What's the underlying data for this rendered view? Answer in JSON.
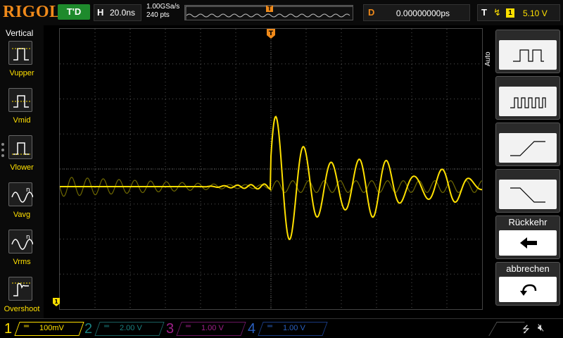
{
  "header": {
    "logo": "RIGOL",
    "trigger_status": "T'D",
    "horizontal_letter": "H",
    "timebase": "20.0ns",
    "sample_rate": "1.00GSa/s",
    "memory_depth": "240 pts",
    "memory_marker": "T",
    "delay_letter": "D",
    "delay_value": "0.00000000ps",
    "trigger_letter": "T",
    "trigger_edge_icon": "rising-edge-icon",
    "trigger_source": "1",
    "trigger_level": "5.10 V"
  },
  "sidebar": {
    "title": "Vertical",
    "items": [
      {
        "label": "Vupper",
        "icon": "vupper-icon"
      },
      {
        "label": "Vmid",
        "icon": "vmid-icon"
      },
      {
        "label": "Vlower",
        "icon": "vlower-icon"
      },
      {
        "label": "Vavg",
        "icon": "vavg-icon"
      },
      {
        "label": "Vrms",
        "icon": "vrms-icon"
      },
      {
        "label": "Overshoot",
        "icon": "overshoot-icon"
      }
    ]
  },
  "screen": {
    "trigger_position_marker": "T",
    "channel1_ground_marker": "1",
    "colors": {
      "channel1": "#ffe000",
      "grid": "#555555",
      "marker": "#f08a1a"
    }
  },
  "menu": {
    "mode_label": "Auto",
    "buttons": [
      {
        "icon": "pulse-single-icon"
      },
      {
        "icon": "pulse-train-icon"
      },
      {
        "icon": "rising-ramp-icon"
      },
      {
        "icon": "falling-ramp-icon"
      }
    ],
    "back_label": "Rückkehr",
    "back_icon": "left-arrow-icon",
    "cancel_label": "abbrechen",
    "cancel_icon": "undo-icon"
  },
  "channels": [
    {
      "number": "1",
      "scale": "100mV",
      "color": "#ffe000",
      "coupling": "DC"
    },
    {
      "number": "2",
      "scale": "2.00 V",
      "color": "#1a8080",
      "coupling": "DC"
    },
    {
      "number": "3",
      "scale": "1.00 V",
      "color": "#a0208a",
      "coupling": "DC"
    },
    {
      "number": "4",
      "scale": "1.00 V",
      "color": "#1a4aa0",
      "coupling": "DC"
    }
  ],
  "status": {
    "usb_icon": "usb-icon",
    "speaker_icon": "speaker-muted-icon"
  }
}
